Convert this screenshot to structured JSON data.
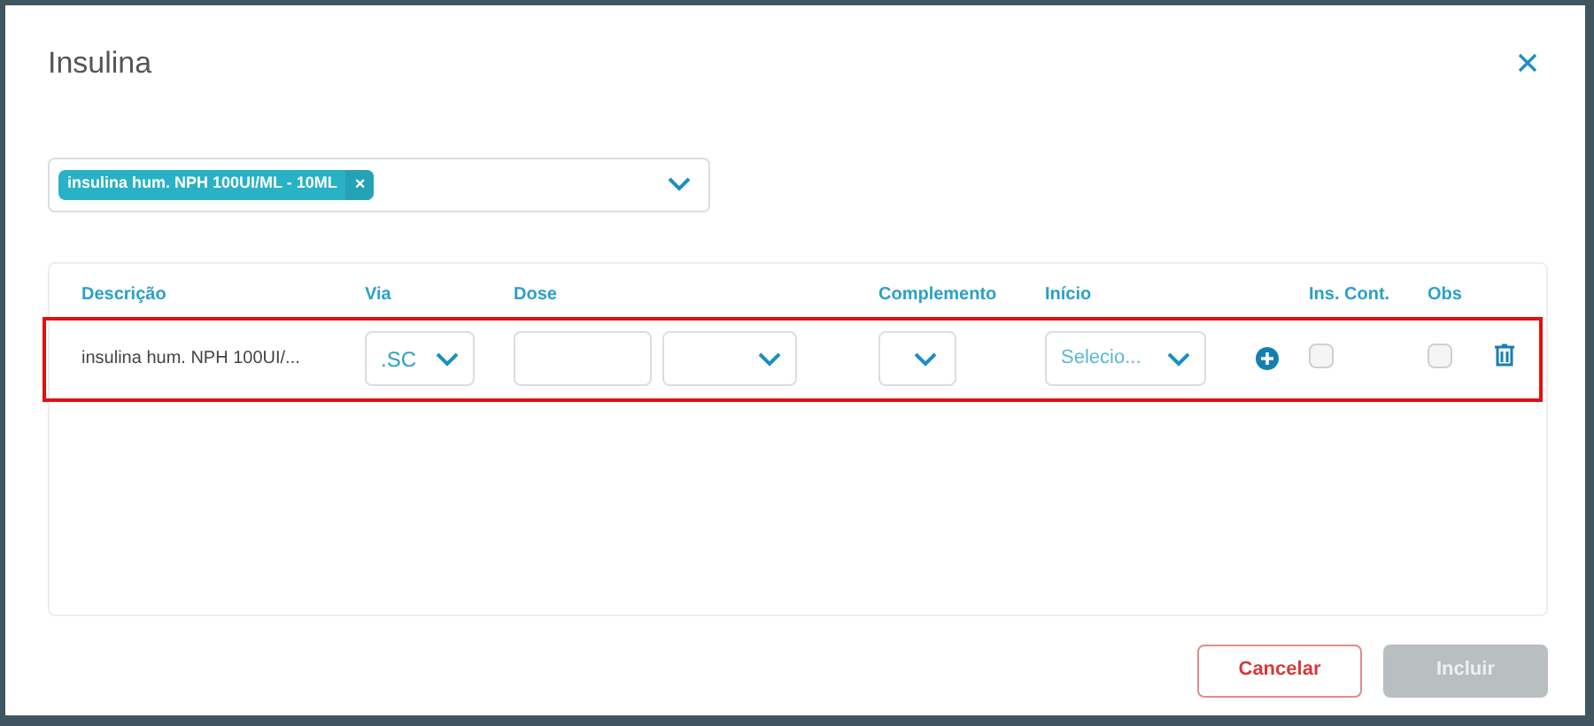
{
  "dialog": {
    "title": "Insulina"
  },
  "product_select": {
    "chips": [
      {
        "label": "insulina hum. NPH 100UI/ML - 10ML",
        "remove": "×"
      }
    ]
  },
  "table": {
    "columns": [
      "Descrição",
      "Via",
      "Dose",
      "Complemento",
      "Início",
      "Ins. Cont.",
      "Obs"
    ],
    "rows": [
      {
        "highlighted": true,
        "description": "insulina hum. NPH 100UI/...",
        "via": ".SC",
        "dose": {},
        "inicio": {
          "placeholder": "Selecio..."
        },
        "ins_cont": {
          "checked": false
        },
        "obs": {
          "checked": false
        }
      }
    ]
  },
  "buttons": [
    {
      "label": "Cancelar",
      "kind": "outline",
      "disabled": false
    },
    {
      "label": "Incluir",
      "kind": "primary",
      "disabled": true
    }
  ]
}
